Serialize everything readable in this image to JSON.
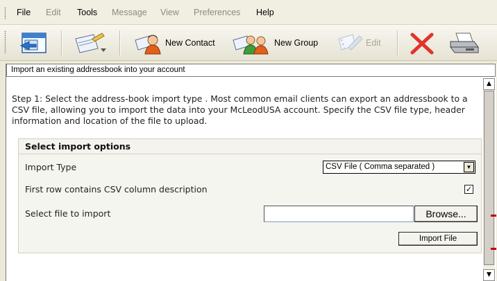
{
  "menu": {
    "items": [
      {
        "label": "File",
        "enabled": true
      },
      {
        "label": "Edit",
        "enabled": false
      },
      {
        "label": "Tools",
        "enabled": true
      },
      {
        "label": "Message",
        "enabled": false
      },
      {
        "label": "View",
        "enabled": false
      },
      {
        "label": "Preferences",
        "enabled": false
      },
      {
        "label": "Help",
        "enabled": true
      }
    ]
  },
  "toolbar": {
    "new_contact_label": "New Contact",
    "new_group_label": "New Group",
    "edit_label": "Edit",
    "icons": [
      "address-book-icon",
      "compose-card-icon",
      "new-contact-icon",
      "new-group-icon",
      "edit-icon",
      "delete-icon",
      "print-icon"
    ]
  },
  "panel": {
    "title": "Import an existing addressbook into your account",
    "intro": "Step 1: Select the address-book import type . Most common email clients can export an addressbook to a CSV file, allowing you to import the data into your McLeodUSA account. Specify the CSV file type, header information and location of the file to upload."
  },
  "options": {
    "heading": "Select import options",
    "import_type_label": "Import Type",
    "import_type_value": "CSV File ( Comma separated )",
    "first_row_label": "First row contains CSV column description",
    "first_row_checked": true,
    "checkmark": "✓",
    "file_label": "Select file to import",
    "file_value": "",
    "browse_label": "Browse...",
    "import_button_label": "Import File"
  },
  "scroll": {
    "up_glyph": "▲",
    "down_glyph": "▼",
    "select_glyph": "▼"
  },
  "colors": {
    "delete_red": "#e0352b",
    "marker_red": "#c00000"
  }
}
